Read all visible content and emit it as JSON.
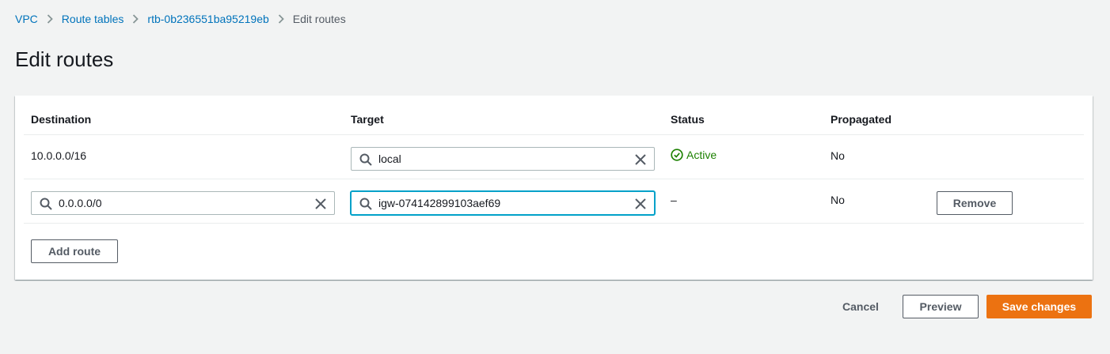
{
  "breadcrumb": {
    "items": [
      "VPC",
      "Route tables",
      "rtb-0b236551ba95219eb"
    ],
    "current": "Edit routes"
  },
  "page": {
    "title": "Edit routes"
  },
  "table": {
    "headers": {
      "destination": "Destination",
      "target": "Target",
      "status": "Status",
      "propagated": "Propagated"
    },
    "rows": [
      {
        "destination": "10.0.0.0/16",
        "target": "local",
        "status": "Active",
        "propagated": "No"
      },
      {
        "destination": "0.0.0.0/0",
        "target": "igw-074142899103aef69",
        "status": "–",
        "propagated": "No",
        "remove_label": "Remove"
      }
    ],
    "add_route_label": "Add route"
  },
  "footer": {
    "cancel_label": "Cancel",
    "preview_label": "Preview",
    "save_label": "Save changes"
  },
  "colors": {
    "link": "#0073bb",
    "primary": "#ec7211",
    "success": "#1d8102",
    "focus": "#00a1c9"
  }
}
